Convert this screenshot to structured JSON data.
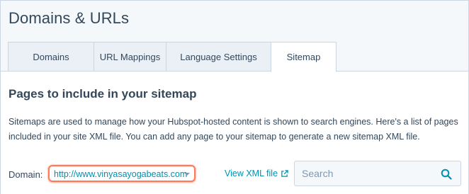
{
  "page": {
    "title": "Domains & URLs"
  },
  "tabs": [
    {
      "label": "Domains"
    },
    {
      "label": "URL Mappings"
    },
    {
      "label": "Language Settings"
    },
    {
      "label": "Sitemap",
      "active": true
    }
  ],
  "sitemap": {
    "heading": "Pages to include in your sitemap",
    "description_line1": "Sitemaps are used to manage how your Hubspot-hosted content is shown to search engines. Here's a list of pages",
    "description_line2": "included in your site XML file. You can add any page to your sitemap to generate a new sitemap XML file.",
    "domain_label": "Domain:",
    "domain_value": "http://www.vinyasayogabeats.com",
    "view_xml_label": "View XML file",
    "search_placeholder": "Search"
  },
  "colors": {
    "link": "#0091ae",
    "highlight": "#ff7a59",
    "text": "#33475b",
    "border": "#cbd6e2"
  },
  "icons": {
    "external_link": "external-link-icon",
    "search": "search-icon",
    "dropdown": "caret-down-icon"
  }
}
